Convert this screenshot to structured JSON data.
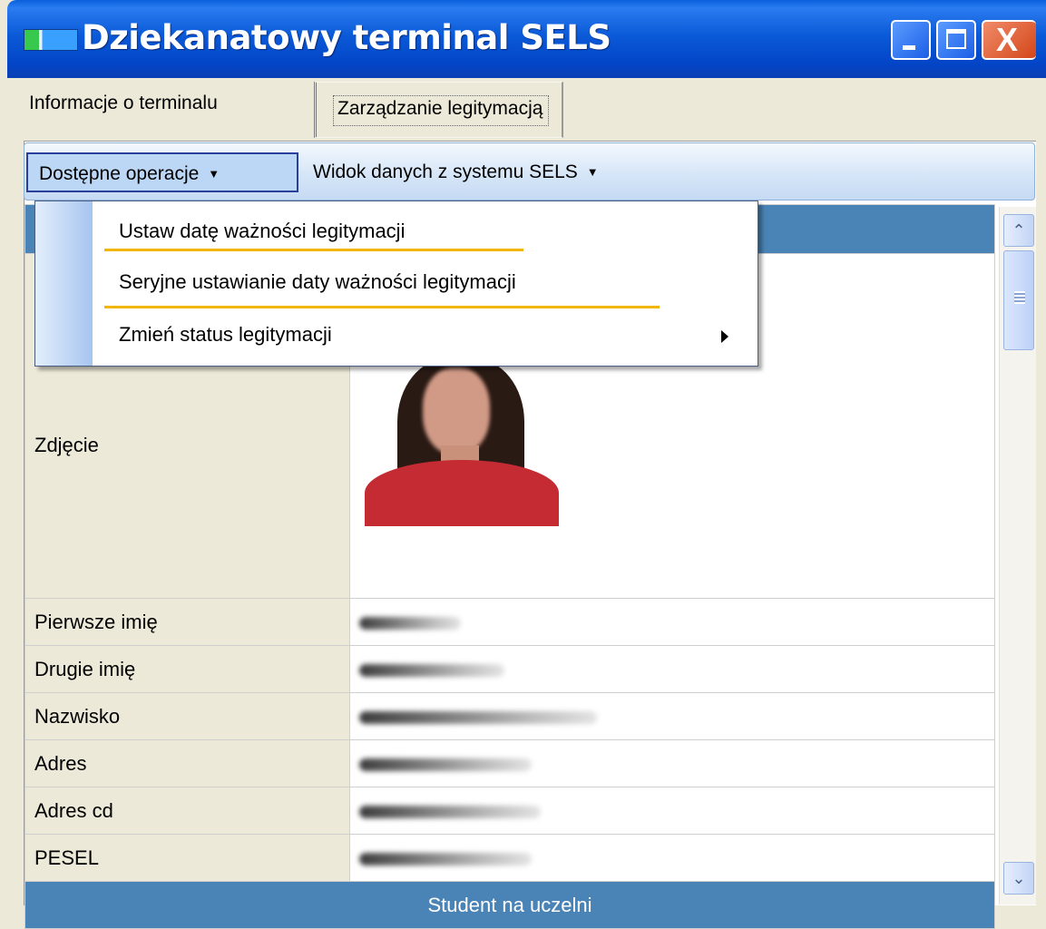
{
  "window": {
    "title": "Dziekanatowy terminal SELS",
    "controls": {
      "minimize_icon": "minimize-icon",
      "maximize_icon": "maximize-icon",
      "close_icon": "close-icon",
      "close_glyph": "X"
    }
  },
  "tabs": [
    {
      "label": "Informacje o terminalu"
    },
    {
      "label": "Zarządzanie legitymacją"
    }
  ],
  "toolbar": {
    "operations_label": "Dostępne operacje",
    "view_label": "Widok danych z systemu SELS",
    "caret": "▼"
  },
  "menu": {
    "items": [
      {
        "label": "Ustaw datę ważności legitymacji"
      },
      {
        "label": "Seryjne ustawianie daty ważności legitymacji"
      },
      {
        "label": "Zmień status legitymacji"
      }
    ]
  },
  "data_grid": {
    "photo_label": "Zdjęcie",
    "rows": [
      {
        "label": "Pierwsze imię"
      },
      {
        "label": "Drugie imię"
      },
      {
        "label": "Nazwisko"
      },
      {
        "label": "Adres"
      },
      {
        "label": "Adres cd"
      },
      {
        "label": "PESEL"
      }
    ],
    "section_title": "Student na uczelni"
  },
  "scrollbar": {
    "up_glyph": "⌃",
    "down_glyph": "⌄"
  },
  "colors": {
    "titlebar": "#0b5ad8",
    "header_row": "#4a84b6",
    "menu_underline": "#f2b500",
    "toolbar_active": "#bcd7f5"
  }
}
